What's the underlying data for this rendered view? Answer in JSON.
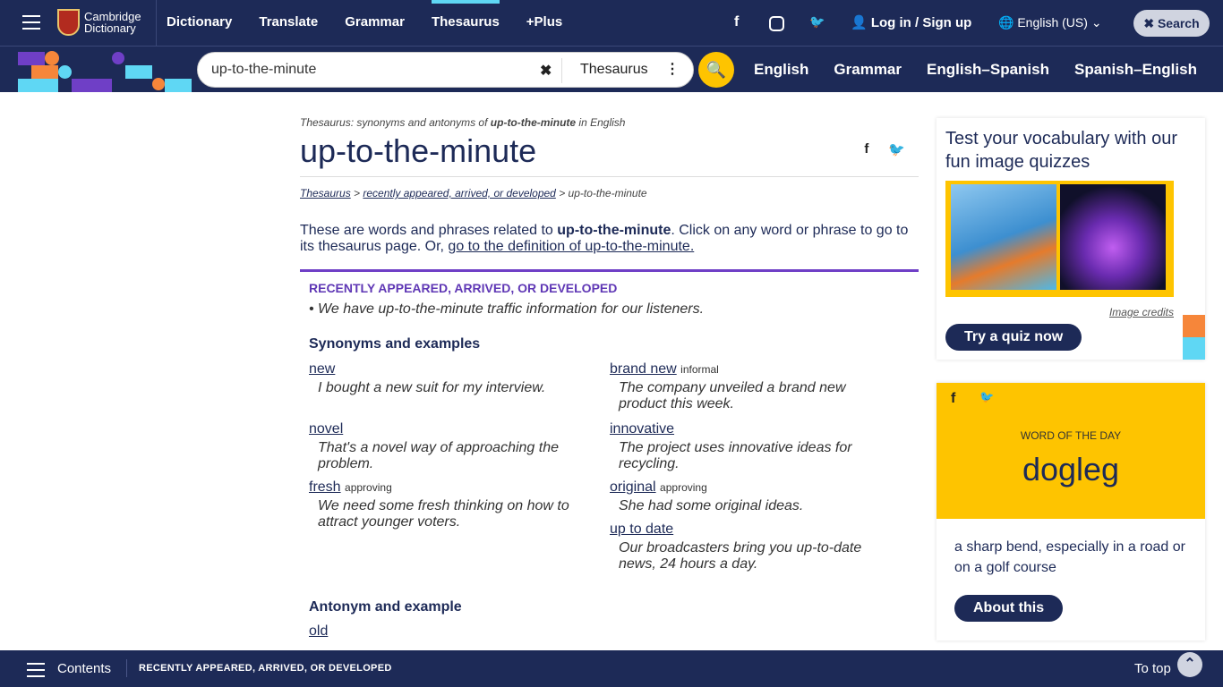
{
  "header": {
    "logo_line1": "Cambridge",
    "logo_line2": "Dictionary",
    "nav": [
      "Dictionary",
      "Translate",
      "Grammar",
      "Thesaurus",
      "+Plus"
    ],
    "active_nav": "Thesaurus",
    "login": "Log in / Sign up",
    "language": "English (US)",
    "search_button": "Search"
  },
  "search": {
    "value": "up-to-the-minute",
    "dataset": "Thesaurus",
    "subnav": [
      "English",
      "Grammar",
      "English–Spanish",
      "Spanish–English"
    ]
  },
  "main": {
    "subtitle_pre": "Thesaurus: synonyms and antonyms of ",
    "subtitle_word": "up-to-the-minute",
    "subtitle_post": " in English",
    "title": "up-to-the-minute",
    "breadcrumb": [
      "Thesaurus",
      "recently appeared, arrived, or developed",
      "up-to-the-minute"
    ],
    "intro_pre": "These are words and phrases related to ",
    "intro_word": "up-to-the-minute",
    "intro_mid": ". Click on any word or phrase to go to its thesaurus page. Or, ",
    "intro_link": "go to the definition of up-to-the-minute.",
    "section_heading": "RECENTLY APPEARED, ARRIVED, OR DEVELOPED",
    "section_example": "We have up-to-the-minute traffic information for our listeners.",
    "synonyms_heading": "Synonyms and examples",
    "synonyms_left": [
      {
        "word": "new",
        "label": "",
        "example": "I bought a new suit for my interview."
      },
      {
        "word": "novel",
        "label": "",
        "example": "That's a novel way of approaching the problem."
      },
      {
        "word": "fresh",
        "label": "approving",
        "example": "We need some fresh thinking on how to attract younger voters."
      }
    ],
    "synonyms_right": [
      {
        "word": "brand new",
        "label": "informal",
        "example": "The company unveiled a brand new product this week."
      },
      {
        "word": "innovative",
        "label": "",
        "example": "The project uses innovative ideas for recycling."
      },
      {
        "word": "original",
        "label": "approving",
        "example": "She had some original ideas."
      },
      {
        "word": "up to date",
        "label": "",
        "example": "Our broadcasters bring you up-to-date news, 24 hours a day."
      }
    ],
    "antonym_heading": "Antonym and example",
    "antonym": "old"
  },
  "sidebar": {
    "quiz_title": "Test your vocabulary with our fun image quizzes",
    "image_credits": "Image credits",
    "quiz_button": "Try a quiz now",
    "wotd_label": "WORD OF THE DAY",
    "wotd_word": "dogleg",
    "wotd_definition": "a sharp bend, especially in a road or on a golf course",
    "wotd_button": "About this"
  },
  "footer": {
    "contents": "Contents",
    "section": "RECENTLY APPEARED, ARRIVED, OR DEVELOPED",
    "to_top": "To top"
  },
  "colors": {
    "navy": "#1d2a57",
    "purple": "#6f3fc6",
    "yellow": "#fec400",
    "cyan": "#5fd7f4",
    "orange": "#f6863a"
  }
}
